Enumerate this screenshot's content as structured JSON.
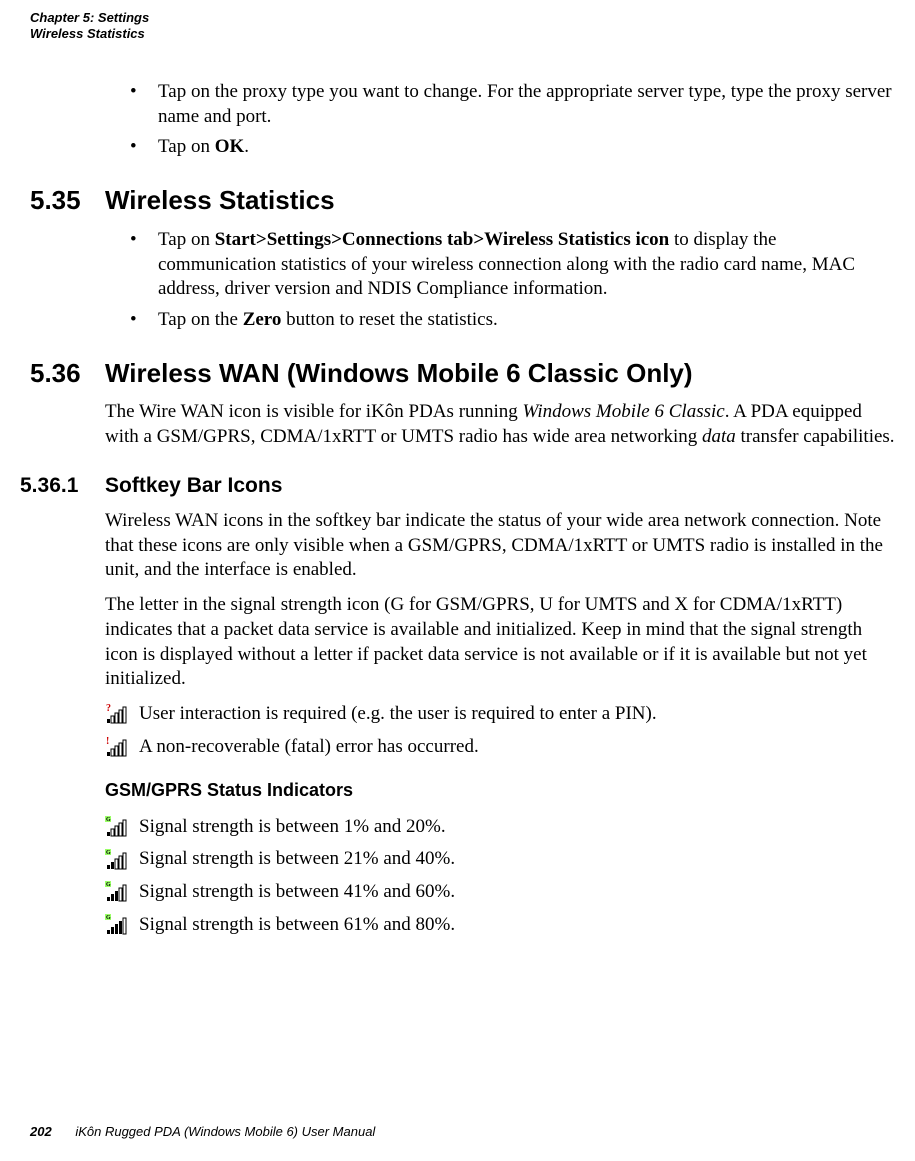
{
  "header": {
    "line1": "Chapter 5:  Settings",
    "line2": "Wireless Statistics"
  },
  "intro_bullets": {
    "b1_pre": "Tap on the proxy type you want to change. For the appropriate server type, type the proxy server name and port.",
    "b2_pre": "Tap on ",
    "b2_bold": "OK",
    "b2_post": "."
  },
  "sec535": {
    "num": "5.35",
    "title": "Wireless Statistics",
    "b1_pre": "Tap on ",
    "b1_bold": "Start>Settings>Connections tab>Wireless Statistics icon",
    "b1_post": " to display the communication statistics of your wireless connection along with the radio card name, MAC address, driver version and NDIS Compliance information.",
    "b2_pre": "Tap on the ",
    "b2_bold": "Zero",
    "b2_post": " button to reset the statistics."
  },
  "sec536": {
    "num": "5.36",
    "title": "Wireless WAN (Windows Mobile 6 Classic Only)",
    "para_pre": "The Wire WAN icon is visible for iKôn PDAs running ",
    "para_em": "Windows Mobile 6 Classic",
    "para_mid": ". A PDA equipped with a GSM/GPRS, CDMA/1xRTT or UMTS radio has wide area networking ",
    "para_em2": "data",
    "para_post": " transfer capabilities."
  },
  "sec5361": {
    "num": "5.36.1",
    "title": "Softkey Bar Icons",
    "para1": "Wireless WAN icons in the softkey bar indicate the status of your wide area network connection. Note that these icons are only visible when a GSM/GPRS, CDMA/1xRTT or UMTS radio is installed in the unit, and the interface is enabled.",
    "para2": "The letter in the signal strength icon (G for GSM/GPRS, U for UMTS and X for CDMA/1xRTT) indicates that a packet data service is available and initialized. Keep in mind that the signal strength icon is displayed without a letter if packet data service is not available or if it is available but not yet initialized.",
    "icon1_text": "User interaction is required (e.g. the user is required to enter a PIN).",
    "icon2_text": "A non-recoverable (fatal) error has occurred."
  },
  "gsm_heading": "GSM/GPRS Status Indicators",
  "gsm_signals": {
    "s1": "Signal strength is between 1% and 20%.",
    "s2": "Signal strength is between 21% and 40%.",
    "s3": "Signal strength is between 41% and 60%.",
    "s4": "Signal strength is between 61% and 80%."
  },
  "footer": {
    "page": "202",
    "text": "iKôn Rugged PDA (Windows Mobile 6) User Manual"
  }
}
